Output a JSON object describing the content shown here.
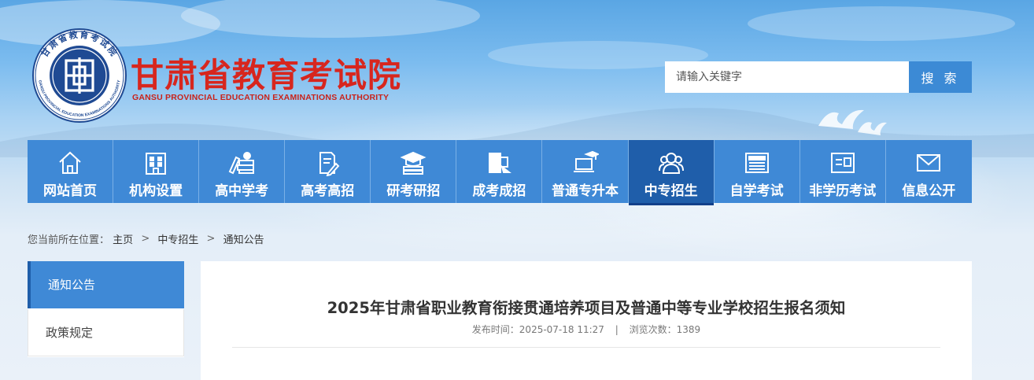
{
  "header": {
    "title": "甘肃省教育考试院",
    "subtitle": "GANSU PROVINCIAL EDUCATION EXAMINATIONS AUTHORITY",
    "emblem_ring_text": "甘肃省教育考试院",
    "emblem_ring_text_en": "GANSU PROVINCIAL EDUCATION EXAMINATIONS AUTHORITY"
  },
  "search": {
    "placeholder": "请输入关键字",
    "button_label": "搜 索"
  },
  "nav": {
    "items": [
      {
        "label": "网站首页",
        "icon": "home-icon"
      },
      {
        "label": "机构设置",
        "icon": "building-icon"
      },
      {
        "label": "高中学考",
        "icon": "books-icon"
      },
      {
        "label": "高考高招",
        "icon": "document-pen-icon"
      },
      {
        "label": "研考研招",
        "icon": "graduation-cap-icon"
      },
      {
        "label": "成考成招",
        "icon": "book-flag-icon"
      },
      {
        "label": "普通专升本",
        "icon": "laptop-cap-icon"
      },
      {
        "label": "中专招生",
        "icon": "people-icon",
        "active": true
      },
      {
        "label": "自学考试",
        "icon": "newspaper-icon"
      },
      {
        "label": "非学历考试",
        "icon": "id-card-icon"
      },
      {
        "label": "信息公开",
        "icon": "mail-icon"
      }
    ]
  },
  "breadcrumb": {
    "prefix": "您当前所在位置：",
    "items": [
      "主页",
      "中专招生",
      "通知公告"
    ],
    "separator": ">"
  },
  "sidebar": {
    "items": [
      {
        "label": "通知公告",
        "active": true
      },
      {
        "label": "政策规定",
        "active": false
      }
    ]
  },
  "article": {
    "title": "2025年甘肃省职业教育衔接贯通培养项目及普通中等专业学校招生报名须知",
    "published_label": "发布时间：",
    "published_value": "2025-07-18 11:27",
    "meta_separator": "|",
    "views_label": "浏览次数：",
    "views_value": "1389"
  },
  "colors": {
    "brand_red": "#d7261e",
    "nav_blue": "#3f89d6",
    "nav_active": "#1f5eaa",
    "search_button": "#3c8ad5"
  }
}
